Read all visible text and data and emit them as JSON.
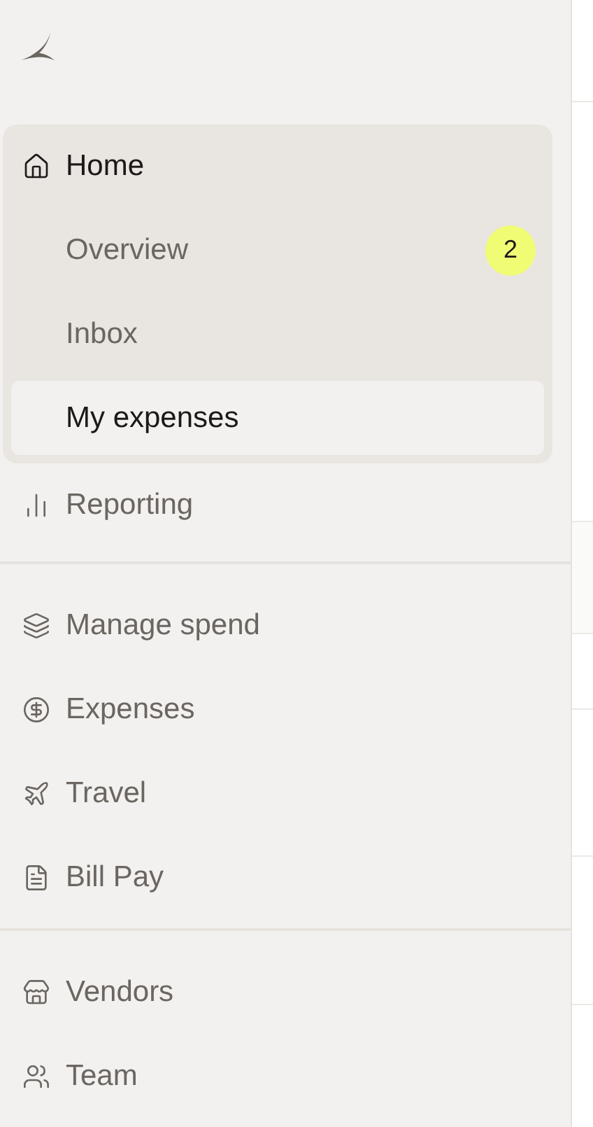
{
  "sidebar": {
    "sections": [
      {
        "items": [
          {
            "label": "Home",
            "expanded": true,
            "children": [
              {
                "label": "Overview",
                "selected": false,
                "badge": "2"
              },
              {
                "label": "Inbox",
                "selected": false
              },
              {
                "label": "My expenses",
                "selected": true
              }
            ]
          },
          {
            "label": "Reporting",
            "expanded": false
          }
        ]
      },
      {
        "items": [
          {
            "label": "Manage spend"
          },
          {
            "label": "Expenses"
          },
          {
            "label": "Travel"
          },
          {
            "label": "Bill Pay"
          }
        ]
      },
      {
        "items": [
          {
            "label": "Vendors"
          },
          {
            "label": "Team"
          }
        ]
      }
    ]
  }
}
